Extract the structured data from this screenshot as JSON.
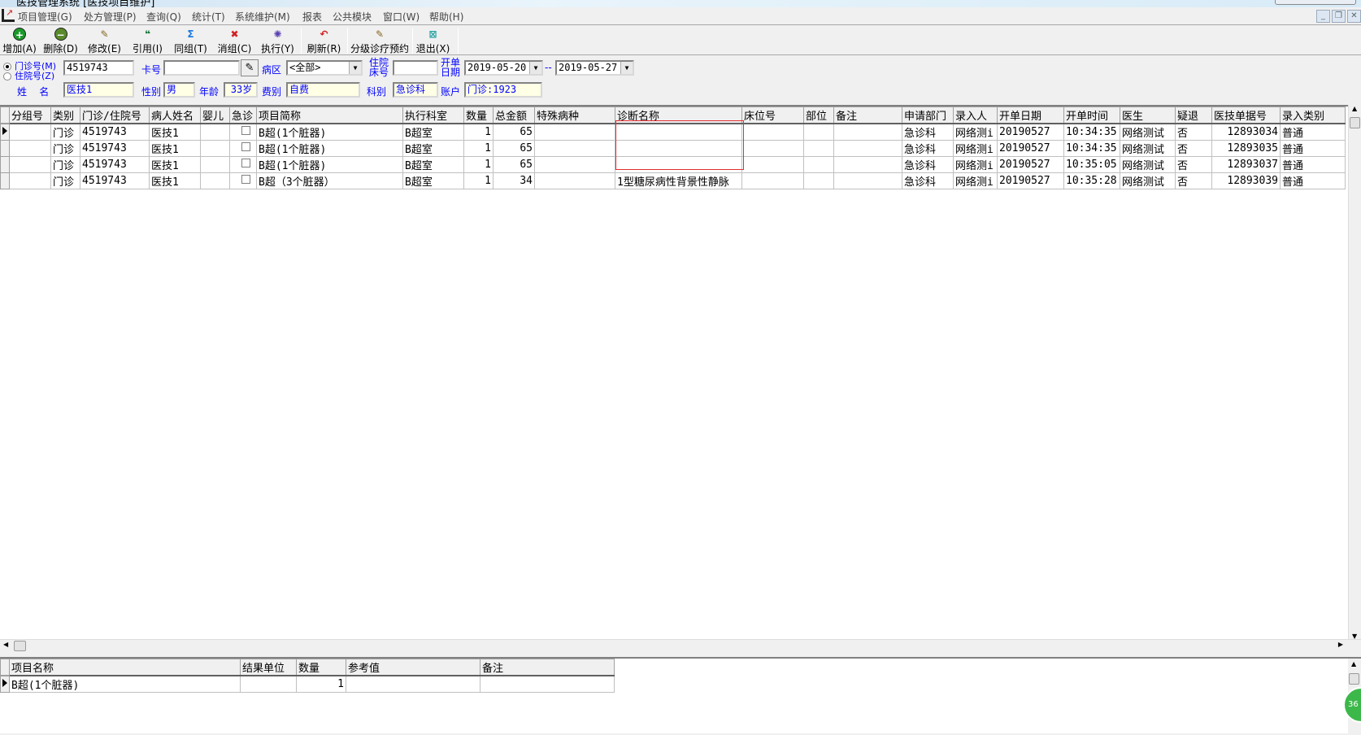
{
  "window": {
    "title": "医技管理系统  [医技项目维护]"
  },
  "menu": [
    "项目管理(G)",
    "处方管理(P)",
    "查询(Q)",
    "统计(T)",
    "系统维护(M)",
    "报表",
    "公共模块",
    "窗口(W)",
    "帮助(H)"
  ],
  "toolbar": [
    {
      "label": "增加(A)",
      "icon": "plus-circle-icon",
      "color": "#1a9a2a"
    },
    {
      "label": "删除(D)",
      "icon": "minus-circle-icon",
      "color": "#5a8a2a"
    },
    {
      "label": "修改(E)",
      "icon": "edit-document-icon",
      "color": "#886622"
    },
    {
      "label": "引用(I)",
      "icon": "quote-icon",
      "color": "#1a7a3a"
    },
    {
      "label": "同组(T)",
      "icon": "sigma-icon",
      "color": "#1a7adf"
    },
    {
      "label": "消组(C)",
      "icon": "delete-group-icon",
      "color": "#d02020"
    },
    {
      "label": "执行(Y)",
      "icon": "gear-icon",
      "color": "#5a40b0"
    },
    {
      "label": "刷新(R)",
      "icon": "refresh-icon",
      "color": "#d02020"
    },
    {
      "label": "分级诊疗预约",
      "icon": "appointment-icon",
      "color": "#886622"
    },
    {
      "label": "退出(X)",
      "icon": "exit-icon",
      "color": "#20a0a0"
    }
  ],
  "form": {
    "radio_outpatient": "门诊号(M)",
    "radio_inpatient": "住院号(Z)",
    "patient_no": "4519743",
    "card_label": "卡号",
    "card_value": "",
    "ward_label": "病区",
    "ward_value": "<全部>",
    "bed_label": "住院床号",
    "bed_value": "",
    "date_label": "开单日期",
    "date_from": "2019-05-20",
    "date_sep": "--",
    "date_to": "2019-05-27",
    "name_label": "姓    名",
    "name_value": "医技1",
    "sex_label": "性别",
    "sex_value": "男",
    "age_label": "年龄",
    "age_value": "33岁",
    "fee_label": "费别",
    "fee_value": "自费",
    "dept_label": "科别",
    "dept_value": "急诊科",
    "account_label": "账户",
    "account_value": "门诊:1923"
  },
  "grid": {
    "columns": [
      "分组号",
      "类别",
      "门诊/住院号",
      "病人姓名",
      "婴儿",
      "急诊",
      "项目简称",
      "执行科室",
      "数量",
      "总金额",
      "特殊病种",
      "诊断名称",
      "床位号",
      "部位",
      "备注",
      "申请部门",
      "录入人",
      "开单日期",
      "开单时间",
      "医生",
      "疑退",
      "医技单据号",
      "录入类别"
    ],
    "rows": [
      [
        "",
        "门诊",
        "4519743",
        "医技1",
        "",
        false,
        "B超(1个脏器)",
        "B超室",
        "1",
        "65",
        "",
        "",
        "",
        "",
        "",
        "急诊科",
        "网络测i",
        "20190527",
        "10:34:35",
        "网络测试",
        "否",
        "12893034",
        "普通"
      ],
      [
        "",
        "门诊",
        "4519743",
        "医技1",
        "",
        false,
        "B超(1个脏器)",
        "B超室",
        "1",
        "65",
        "",
        "",
        "",
        "",
        "",
        "急诊科",
        "网络测i",
        "20190527",
        "10:34:35",
        "网络测试",
        "否",
        "12893035",
        "普通"
      ],
      [
        "",
        "门诊",
        "4519743",
        "医技1",
        "",
        false,
        "B超(1个脏器)",
        "B超室",
        "1",
        "65",
        "",
        "",
        "",
        "",
        "",
        "急诊科",
        "网络测i",
        "20190527",
        "10:35:05",
        "网络测试",
        "否",
        "12893037",
        "普通"
      ],
      [
        "",
        "门诊",
        "4519743",
        "医技1",
        "",
        false,
        "B超（3个脏器）",
        "B超室",
        "1",
        "34",
        "",
        "1型糖尿病性背景性静脉",
        "",
        "",
        "",
        "急诊科",
        "网络测i",
        "20190527",
        "10:35:28",
        "网络测试",
        "否",
        "12893039",
        "普通"
      ]
    ]
  },
  "detail": {
    "columns": [
      "项目名称",
      "结果单位",
      "数量",
      "参考值",
      "备注"
    ],
    "rows": [
      [
        "B超(1个脏器)",
        "",
        "1",
        "",
        ""
      ]
    ]
  },
  "corner_badge": "36"
}
